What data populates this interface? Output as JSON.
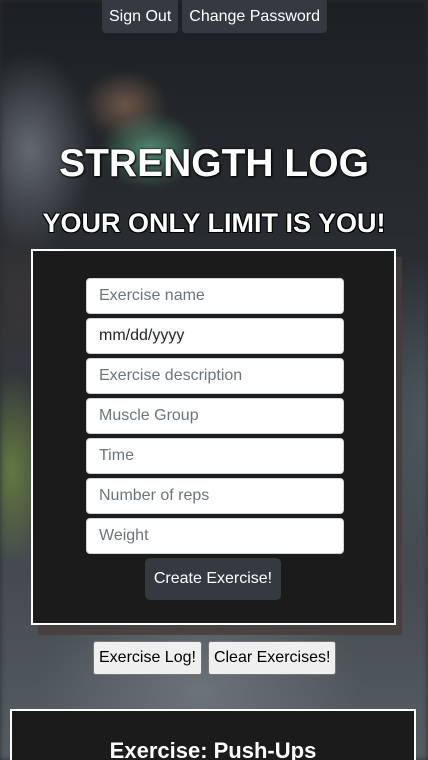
{
  "header": {
    "sign_out_label": "Sign Out",
    "change_password_label": "Change Password"
  },
  "hero": {
    "title": "STRENGTH LOG",
    "tagline": "YOUR ONLY LIMIT IS YOU!"
  },
  "exercise_form": {
    "name_placeholder": "Exercise name",
    "date_placeholder": "mm/dd/yyyy",
    "description_placeholder": "Exercise description",
    "muscle_group_placeholder": "Muscle Group",
    "time_placeholder": "Time",
    "reps_placeholder": "Number of reps",
    "weight_placeholder": "Weight",
    "submit_label": "Create Exercise!"
  },
  "actions": {
    "exercise_log_label": "Exercise Log!",
    "clear_label": "Clear Exercises!"
  },
  "exercise_card": {
    "title": "Exercise: Push-Ups"
  }
}
